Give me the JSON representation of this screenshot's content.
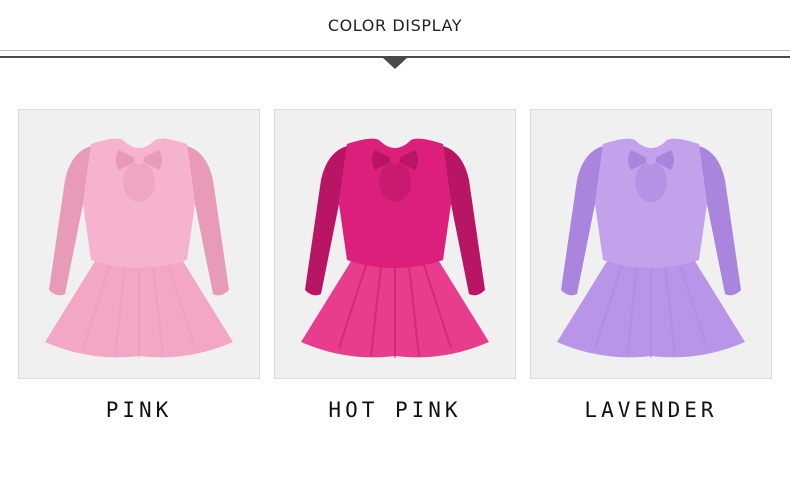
{
  "header": {
    "title": "COLOR DISPLAY"
  },
  "colors": [
    {
      "label": "PINK",
      "dress": "#f6b3cf",
      "dress_dark": "#e89ab9",
      "skirt": "#f4a6c6"
    },
    {
      "label": "HOT PINK",
      "dress": "#dc1f7a",
      "dress_dark": "#b81564",
      "skirt": "#e83c8c"
    },
    {
      "label": "LAVENDER",
      "dress": "#c3a2ec",
      "dress_dark": "#a985dd",
      "skirt": "#b995ea"
    }
  ]
}
